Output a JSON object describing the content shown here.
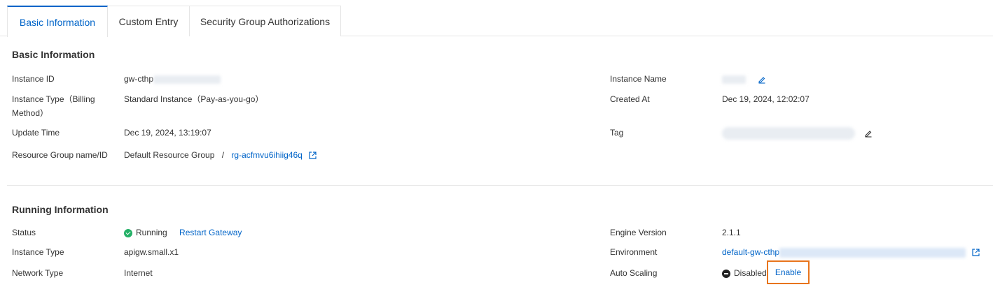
{
  "tabs": [
    {
      "label": "Basic Information",
      "active": true
    },
    {
      "label": "Custom Entry",
      "active": false
    },
    {
      "label": "Security Group Authorizations",
      "active": false
    }
  ],
  "basic": {
    "title": "Basic Information",
    "instance_id_label": "Instance ID",
    "instance_id_value": "gw-cthp",
    "instance_type_label_1": "Instance Type（Billing",
    "instance_type_label_2": "Method）",
    "instance_type_value": "Standard Instance（Pay-as-you-go）",
    "update_time_label": "Update Time",
    "update_time_value": "Dec 19, 2024, 13:19:07",
    "resource_group_label": "Resource Group name/ID",
    "resource_group_name": "Default Resource Group",
    "resource_group_sep": "/",
    "resource_group_id": "rg-acfmvu6ihiig46q",
    "instance_name_label": "Instance Name",
    "created_at_label": "Created At",
    "created_at_value": "Dec 19, 2024, 12:02:07",
    "tag_label": "Tag"
  },
  "running": {
    "title": "Running Information",
    "status_label": "Status",
    "status_value": "Running",
    "restart_link": "Restart Gateway",
    "instance_type_label": "Instance Type",
    "instance_type_value": "apigw.small.x1",
    "network_type_label": "Network Type",
    "network_type_value": "Internet",
    "engine_version_label": "Engine Version",
    "engine_version_value": "2.1.1",
    "environment_label": "Environment",
    "environment_value": "default-gw-cthp",
    "auto_scaling_label": "Auto Scaling",
    "auto_scaling_value": "Disabled",
    "enable_link": "Enable"
  },
  "colors": {
    "accent": "#0064c8",
    "running": "#23b066",
    "highlight": "#e8741c"
  }
}
